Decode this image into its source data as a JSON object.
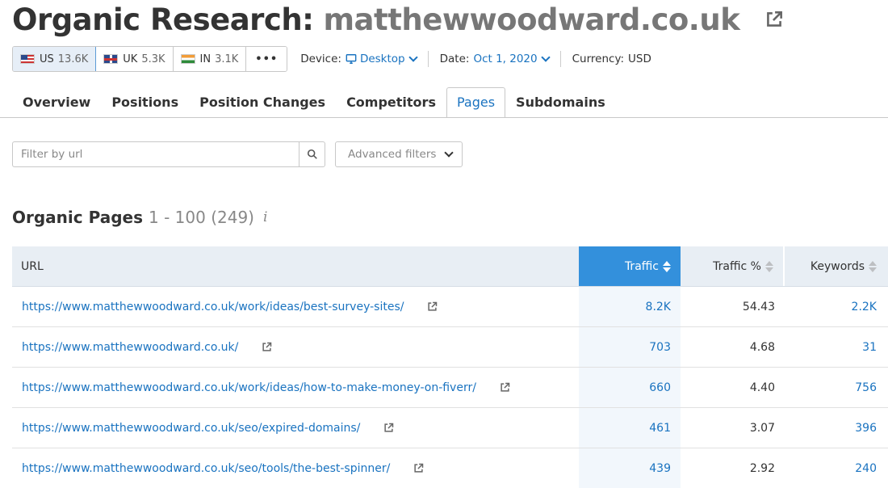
{
  "header": {
    "title_label": "Organic Research:",
    "domain": "matthewwoodward.co.uk"
  },
  "databases": [
    {
      "flag": "us-flag-icon",
      "code": "US",
      "count": "13.6K",
      "active": true
    },
    {
      "flag": "uk-flag-icon",
      "code": "UK",
      "count": "5.3K",
      "active": false
    },
    {
      "flag": "in-flag-icon",
      "code": "IN",
      "count": "3.1K",
      "active": false
    }
  ],
  "more_label": "•••",
  "device": {
    "label": "Device:",
    "value": "Desktop"
  },
  "date": {
    "label": "Date:",
    "value": "Oct 1, 2020"
  },
  "currency": {
    "label": "Currency:",
    "value": "USD"
  },
  "tabs": [
    {
      "label": "Overview",
      "active": false
    },
    {
      "label": "Positions",
      "active": false
    },
    {
      "label": "Position Changes",
      "active": false
    },
    {
      "label": "Competitors",
      "active": false
    },
    {
      "label": "Pages",
      "active": true
    },
    {
      "label": "Subdomains",
      "active": false
    }
  ],
  "filter": {
    "placeholder": "Filter by url",
    "advanced_label": "Advanced filters"
  },
  "section": {
    "name": "Organic Pages",
    "range": "1 - 100 (249)",
    "info": "i"
  },
  "table": {
    "columns": {
      "url": "URL",
      "traffic": "Traffic",
      "traffic_pct": "Traffic %",
      "keywords": "Keywords"
    },
    "rows": [
      {
        "url": "https://www.matthewwoodward.co.uk/work/ideas/best-survey-sites/",
        "traffic": "8.2K",
        "traffic_pct": "54.43",
        "keywords": "2.2K"
      },
      {
        "url": "https://www.matthewwoodward.co.uk/",
        "traffic": "703",
        "traffic_pct": "4.68",
        "keywords": "31"
      },
      {
        "url": "https://www.matthewwoodward.co.uk/work/ideas/how-to-make-money-on-fiverr/",
        "traffic": "660",
        "traffic_pct": "4.40",
        "keywords": "756"
      },
      {
        "url": "https://www.matthewwoodward.co.uk/seo/expired-domains/",
        "traffic": "461",
        "traffic_pct": "3.07",
        "keywords": "396"
      },
      {
        "url": "https://www.matthewwoodward.co.uk/seo/tools/the-best-spinner/",
        "traffic": "439",
        "traffic_pct": "2.92",
        "keywords": "240"
      }
    ]
  },
  "colors": {
    "accent": "#1a73c0",
    "sorted_header": "#3390dc",
    "header_bg": "#e8eef4"
  }
}
